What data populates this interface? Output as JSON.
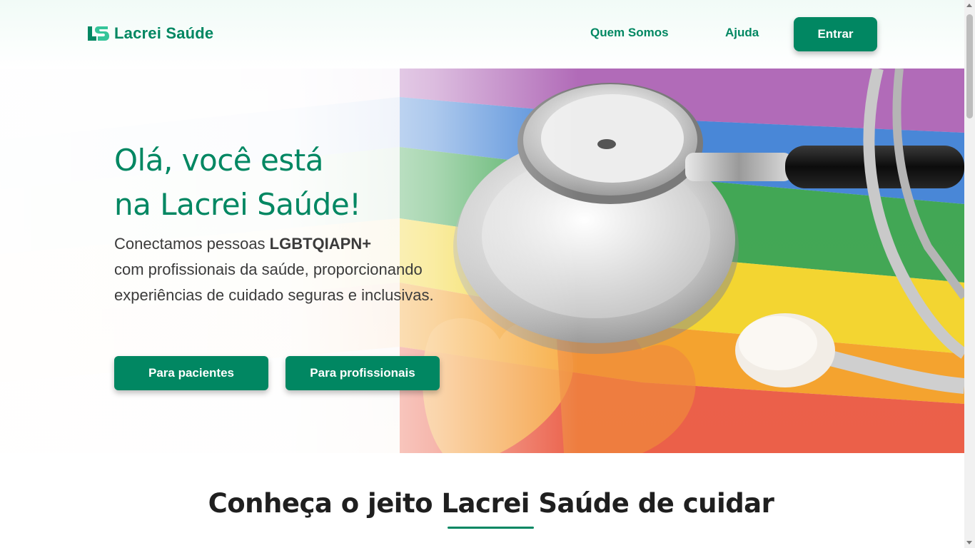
{
  "header": {
    "logo_text": "Lacrei Saúde",
    "logo_icon": "ls-monogram-icon",
    "nav": [
      {
        "label": "Quem Somos"
      },
      {
        "label": "Ajuda"
      }
    ],
    "login_label": "Entrar"
  },
  "hero": {
    "title_line1": "Olá, você está",
    "title_line2": "na Lacrei Saúde!",
    "text_before": "Conectamos pessoas ",
    "text_bold": "LGBTQIAPN+",
    "text_after": "com profissionais da saúde, proporcionando experiências de cuidado seguras e inclusivas.",
    "buttons": [
      {
        "label": "Para pacientes"
      },
      {
        "label": "Para profissionais"
      }
    ],
    "image_icon": "stethoscope-on-rainbow-flag-image"
  },
  "section": {
    "title": "Conheça o jeito Lacrei Saúde de cuidar"
  },
  "colors": {
    "brand": "#018762",
    "text": "#2d2d2d"
  }
}
